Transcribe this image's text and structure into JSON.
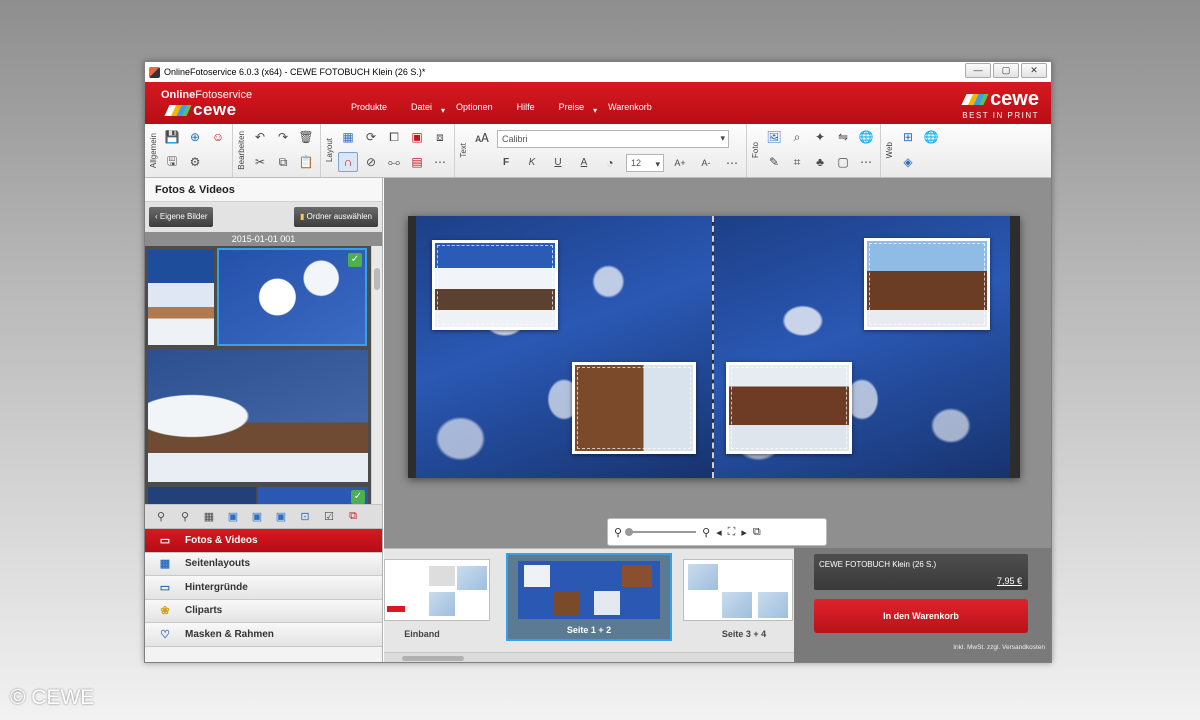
{
  "copyright": "© CEWE",
  "window": {
    "title": "OnlineFotoservice 6.0.3 (x64) - CEWE FOTOBUCH Klein  (26 S.)*",
    "controls": [
      "—",
      "▢",
      "✕"
    ]
  },
  "brand": {
    "service_bold": "Online",
    "service_light": "Fotoservice",
    "logo": "cewe",
    "logo_right": "cewe",
    "tagline": "BEST IN PRINT"
  },
  "menu": [
    {
      "label": "Produkte"
    },
    {
      "label": "Datei"
    },
    {
      "label": "Optionen"
    },
    {
      "label": "Hilfe"
    },
    {
      "label": "Preise"
    },
    {
      "label": "Warenkorb"
    }
  ],
  "toolbar": {
    "groups": {
      "allgemein": "Allgemein",
      "bearbeiten": "Bearbeiten",
      "layout": "Layout",
      "text": "Text",
      "foto": "Foto",
      "web": "Web"
    },
    "font": "Calibri",
    "size": "12",
    "glyphs": {
      "bold": "F",
      "italic": "K",
      "underline": "U",
      "color": "A",
      "grow": "A+",
      "shrink": "A-"
    }
  },
  "left_panel": {
    "title": "Fotos & Videos",
    "btn_own": "Eigene Bilder",
    "btn_folder": "Ordner auswählen",
    "date": "2015-01-01 001",
    "nav": [
      {
        "label": "Fotos & Videos",
        "icon": "photo-icon",
        "active": true
      },
      {
        "label": "Seitenlayouts",
        "icon": "layout-icon"
      },
      {
        "label": "Hintergründe",
        "icon": "background-icon"
      },
      {
        "label": "Cliparts",
        "icon": "clipart-icon"
      },
      {
        "label": "Masken & Rahmen",
        "icon": "mask-icon"
      }
    ]
  },
  "pages": [
    {
      "label": "Einband"
    },
    {
      "label": "Seite 1 + 2",
      "selected": true
    },
    {
      "label": "Seite 3 + 4"
    }
  ],
  "order": {
    "product": "CEWE FOTOBUCH Klein  (26 S.)",
    "price": "7,95 €",
    "cart_button": "In den Warenkorb",
    "ship_note": "Inkl. MwSt. zzgl. Versandkosten"
  },
  "colors": {
    "accent": "#d71920",
    "selection": "#36a1e6"
  }
}
